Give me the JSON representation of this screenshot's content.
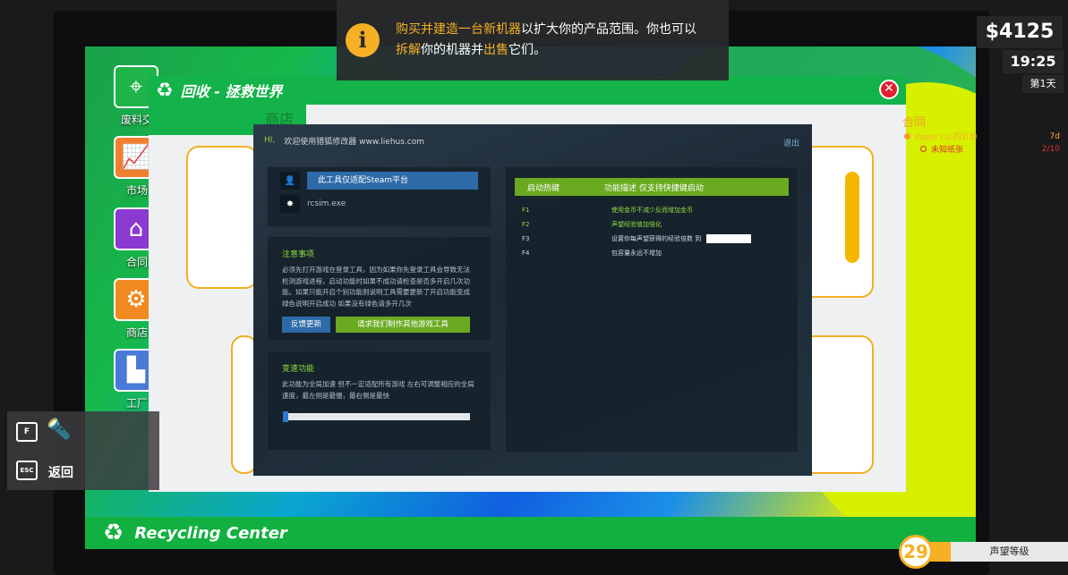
{
  "tooltip": {
    "part1": "购买并建造一台新机器",
    "part2": "以扩大你的产品范围。你也可以",
    "part3": "拆解",
    "part4": "你的机器并",
    "part5": "出售",
    "part6": "它们。"
  },
  "hud": {
    "money": "$4125",
    "time": "19:25",
    "day": "第1天"
  },
  "contracts": {
    "title": "合同",
    "items": [
      {
        "name": "Paper Co.的订单",
        "value": "7d"
      },
      {
        "name": "未知纸张",
        "value": "2/10"
      }
    ]
  },
  "desktop_icons": [
    {
      "label": "废料交",
      "icon": "map-pin-icon",
      "color": "#1fb44a"
    },
    {
      "label": "市场",
      "icon": "chart-icon",
      "color": "#f08030"
    },
    {
      "label": "合同",
      "icon": "store-icon",
      "color": "#8a3ad0"
    },
    {
      "label": "商店",
      "icon": "gear-icon",
      "color": "#f08a20"
    },
    {
      "label": "工厂",
      "icon": "factory-icon",
      "color": "#4a7ad8"
    }
  ],
  "window": {
    "title": "回收 - 拯救世界",
    "tab": "商店"
  },
  "taskbar": {
    "title": "Recycling Center"
  },
  "trainer": {
    "hi": "HI,",
    "welcome": "欢迎使用猎狐修改器 www.liehus.com",
    "exit": "退出",
    "platform": "此工具仅适配Steam平台",
    "exe": "rcsim.exe",
    "notice_title": "注意事项",
    "notice_text": "必须先打开游戏在登录工具，因为如果你先登录工具会导致无法检测游戏进程，启动功能时如果不成功请检查是否多开启几次功能。如果只能开启个别功能则说明工具需要更新了开启功能变成绿色说明开启成功 如果没有绿色请多开几次",
    "feedback_btn": "反馈更新",
    "request_btn": "请求我们制作其他游戏工具",
    "speed_title": "变速功能",
    "speed_text": "此功能为全局加速 但不一定适配所有游戏 左右可调整相应的全局速度，最左侧是最慢，最右侧是最快",
    "hotkey_col": "启动热键",
    "desc_col": "功能描述 仅支持快捷键启动",
    "hotkeys": [
      {
        "key": "F1",
        "desc": "使用金币不减少反而增加金币",
        "active": true
      },
      {
        "key": "F2",
        "desc": "声望经验值加倍化",
        "active": true
      },
      {
        "key": "F3",
        "desc": "设置你每声望获得的经验倍数 到",
        "active": false
      },
      {
        "key": "F4",
        "desc": "包容量永远不增加",
        "active": false
      }
    ]
  },
  "hints": {
    "key_f": "F",
    "key_esc": "ESC",
    "back": "返回"
  },
  "reputation": {
    "level": "29",
    "label": "声望等级"
  }
}
